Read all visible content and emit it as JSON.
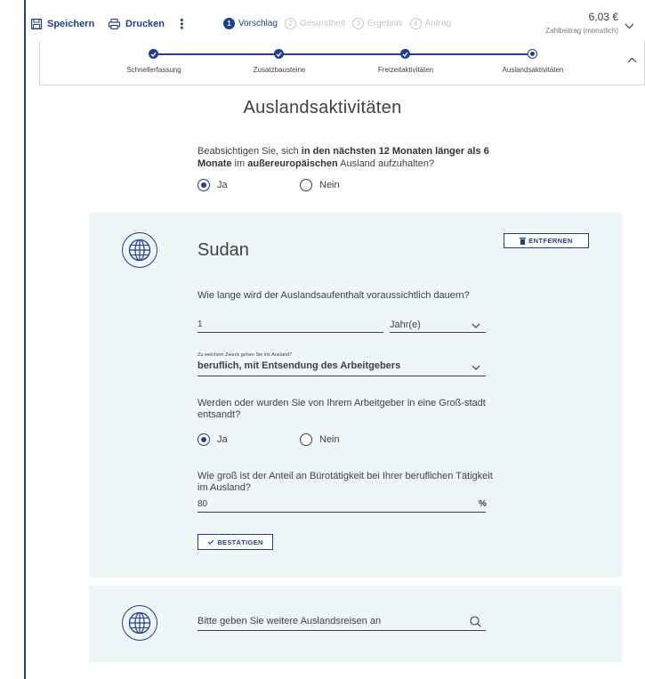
{
  "toolbar": {
    "save_label": "Speichern",
    "print_label": "Drucken",
    "more_label": "⋮"
  },
  "steps": [
    {
      "num": "1",
      "label": "Vorschlag",
      "active": true
    },
    {
      "num": "2",
      "label": "Gesundheit",
      "active": false
    },
    {
      "num": "3",
      "label": "Ergebnis",
      "active": false
    },
    {
      "num": "4",
      "label": "Antrag",
      "active": false
    }
  ],
  "price": {
    "value": "6,03 €",
    "label": "Zahlbeitrag (monatlich)"
  },
  "progress": {
    "items": [
      "Schnellerfassung",
      "Zusatzbausteine",
      "Freizeitaktivitäten",
      "Auslandsaktivitäten"
    ],
    "current_index": 3
  },
  "page": {
    "title": "Auslandsaktivitäten"
  },
  "question1": {
    "text_a": "Beabsichtigen Sie, sich ",
    "text_b": "in den nächsten 12 Monaten länger als 6 Monate",
    "text_c": " im ",
    "text_d": "außereuropäischen",
    "text_e": " Ausland aufzuhalten?",
    "options": [
      "Ja",
      "Nein"
    ],
    "selected": "Ja"
  },
  "country_card": {
    "country": "Sudan",
    "remove_label": "ENTFERNEN",
    "duration": {
      "label": "Wie lange wird der Auslandsaufenthalt voraussichtlich dauern?",
      "value": "1",
      "unit": "Jahr(e)"
    },
    "purpose": {
      "label": "Zu welchem Zweck gehen Sie ins Ausland?",
      "value": "beruflich, mit Entsendung des Arbeitgebers"
    },
    "big_city": {
      "label": "Werden oder wurden Sie von Ihrem Arbeitgeber in eine Groß-stadt entsandt?",
      "options": [
        "Ja",
        "Nein"
      ],
      "selected": "Ja"
    },
    "office_share": {
      "label": "Wie groß ist der Anteil an Bürotätigkeit bei Ihrer beruflichen Tätigkeit im Ausland?",
      "value": "80",
      "unit": "%"
    },
    "confirm_label": "BESTÄTIGEN"
  },
  "search": {
    "placeholder": "Bitte geben Sie weitere Auslandsreisen an"
  },
  "colors": {
    "primary": "#1f3f8f",
    "card_bg": "#eef6f7",
    "text": "#414141"
  }
}
